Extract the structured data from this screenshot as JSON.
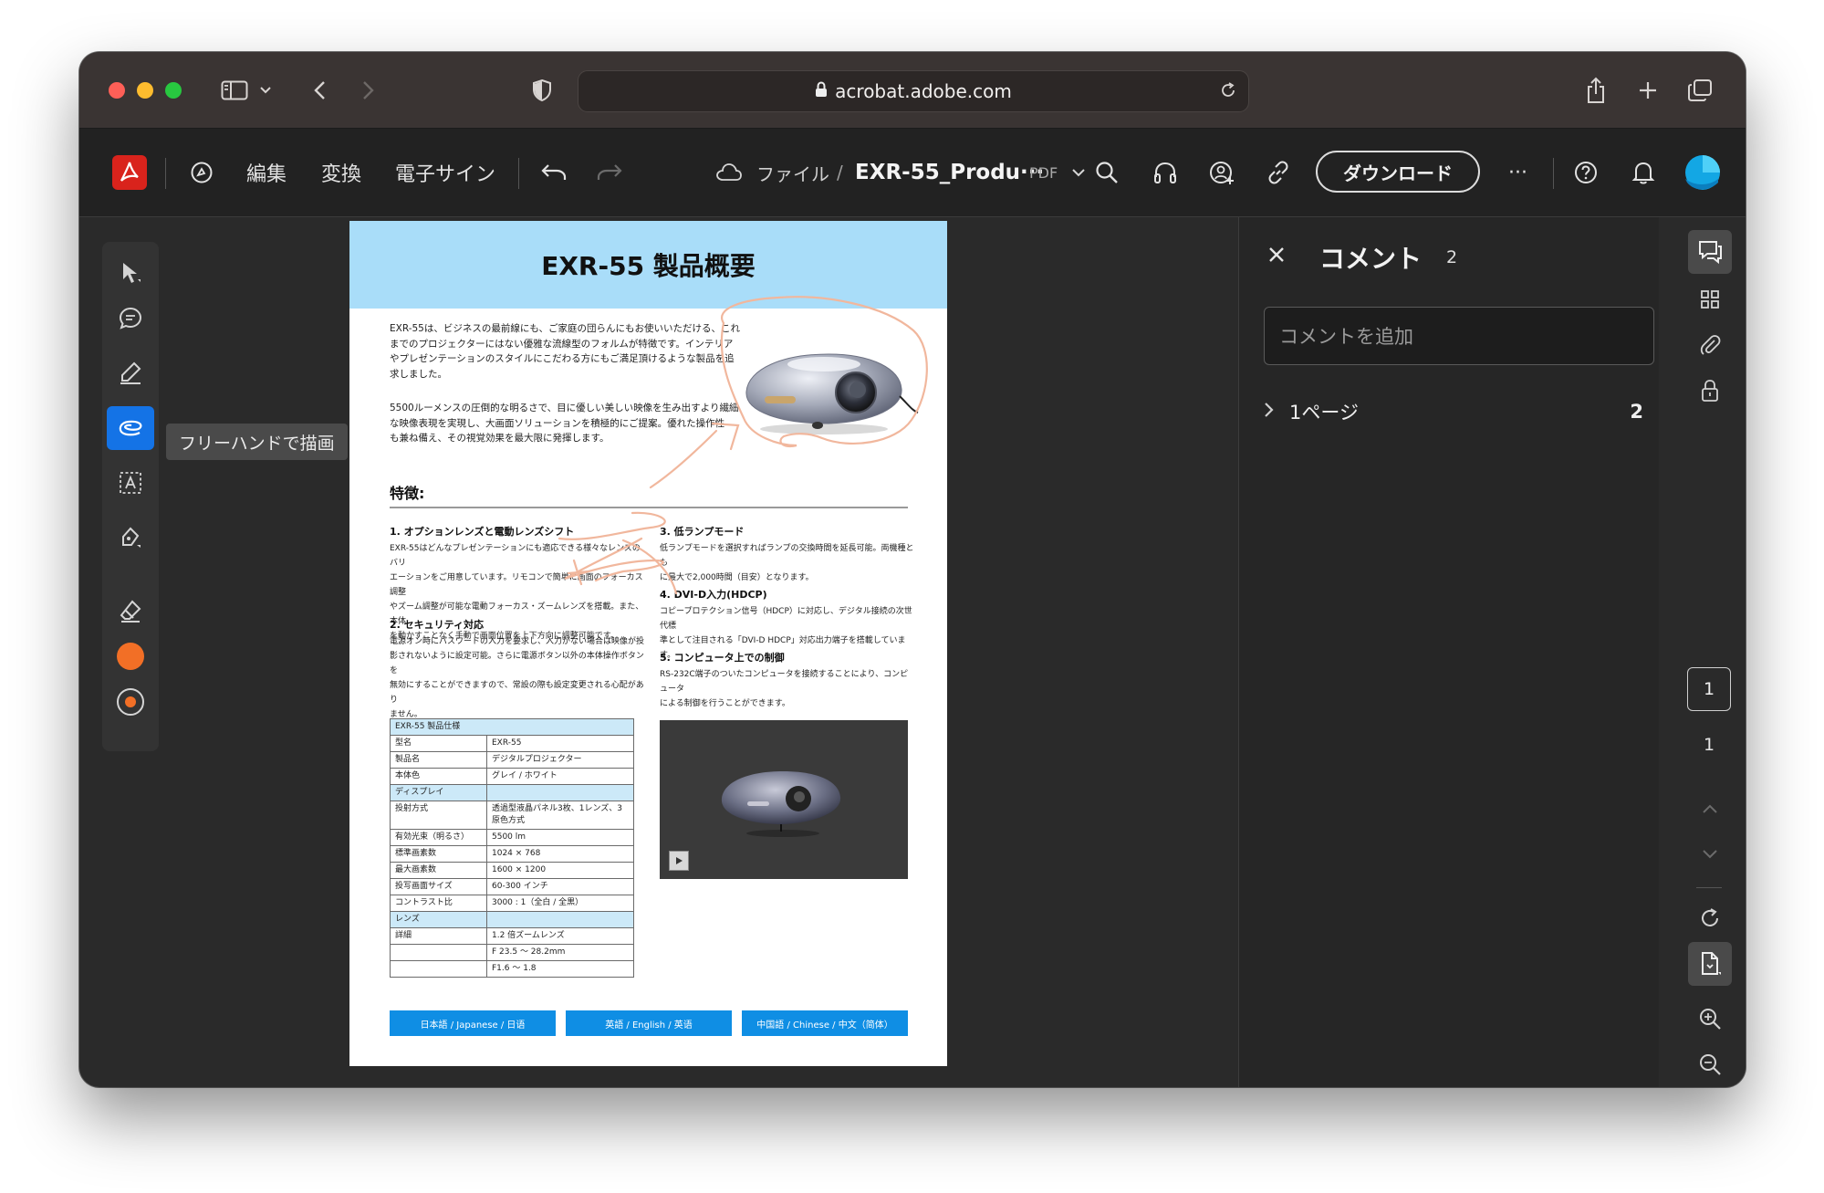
{
  "browser": {
    "url": "acrobat.adobe.com"
  },
  "acrobat": {
    "menu": [
      "編集",
      "変換",
      "電子サイン"
    ],
    "breadcrumb_file": "ファイル",
    "breadcrumb_sep": "/",
    "doc_name": "EXR-55_Produ···",
    "doc_type": "PDF",
    "download_label": "ダウンロード",
    "more_label": "···"
  },
  "tools": {
    "tooltip": "フリーハンドで描画",
    "active": "freehand",
    "accent": "#1473e6",
    "color_swatch": "#f26f26"
  },
  "document": {
    "title": "EXR-55 製品概要",
    "intro1": [
      "EXR-55は、ビジネスの最前線にも、ご家庭の団らんにもお使いいただける、これ",
      "までのプロジェクターにはない優雅な流線型のフォルムが特徴です。インテリア",
      "やプレゼンテーションのスタイルにこだわる方にもご満足頂けるような製品を追",
      "求しました。"
    ],
    "intro2": [
      "5500ルーメンスの圧倒的な明るさで、目に優しい美しい映像を生み出すより繊細",
      "な映像表現を実現し、大画面ソリューションを積極的にご提案。優れた操作性",
      "も兼ね備え、その視覚効果を最大限に発揮します。"
    ],
    "features_title": "特徴:",
    "features": [
      {
        "title": "1. オプションレンズと電動レンズシフト",
        "body": [
          "EXR-55はどんなプレゼンテーションにも適応できる様々なレンズのバリ",
          "エーションをご用意しています。リモコンで簡単に画面のフォーカス調整",
          "やズーム調整が可能な電動フォーカス・ズームレンズを搭載。また、本体",
          "を動かすことなく手動で画面位置を上下方向に調整可能です。"
        ]
      },
      {
        "title": "2. セキュリティ対応",
        "body": [
          "電源オン時にパスワードの入力を要求し、入力がない場合は映像が投",
          "影されないように設定可能。さらに電源ボタン以外の本体操作ボタンを",
          "無効にすることができますので、常設の際も設定変更される心配があり",
          "ません。"
        ]
      },
      {
        "title": "3. 低ランプモード",
        "body": [
          "低ランプモードを選択すればランプの交換時間を延長可能。両機種とも",
          "に最大で2,000時間（目安）となります。"
        ]
      },
      {
        "title": "4. DVI-D入力(HDCP)",
        "body": [
          "コピープロテクション信号（HDCP）に対応し、デジタル接続の次世代標",
          "準として注目される「DVI-D HDCP」対応出力端子を搭載しています。"
        ]
      },
      {
        "title": "5. コンピュータ上での制御",
        "body": [
          "RS-232C端子のついたコンピュータを接続することにより、コンピュータ",
          "による制御を行うことができます。"
        ]
      }
    ],
    "spec_table": [
      {
        "k": "EXR-55 製品仕様",
        "v": "",
        "section": true,
        "span": true
      },
      {
        "k": "型名",
        "v": "EXR-55"
      },
      {
        "k": "製品名",
        "v": "デジタルプロジェクター"
      },
      {
        "k": "本体色",
        "v": "グレイ / ホワイト"
      },
      {
        "k": "ディスプレイ",
        "v": "",
        "section": true
      },
      {
        "k": "投射方式",
        "v": "透過型液晶パネル3枚、1レンズ、3原色方式"
      },
      {
        "k": "有効光束（明るさ）",
        "v": "5500 lm"
      },
      {
        "k": "標準画素数",
        "v": "1024 × 768"
      },
      {
        "k": "最大画素数",
        "v": "1600 × 1200"
      },
      {
        "k": "投写画面サイズ",
        "v": "60-300 インチ"
      },
      {
        "k": "コントラスト比",
        "v": "3000 : 1（全白 / 全黒）"
      },
      {
        "k": "レンズ",
        "v": "",
        "section": true
      },
      {
        "k": "詳細",
        "v": "1.2 倍ズームレンズ"
      },
      {
        "k": "",
        "v": "F 23.5 〜 28.2mm"
      },
      {
        "k": "",
        "v": "F1.6 〜 1.8"
      }
    ],
    "languages": [
      "日本語 / Japanese / 日语",
      "英語 / English / 英语",
      "中国語 / Chinese / 中文（简体）"
    ]
  },
  "comments_panel": {
    "title": "コメント",
    "count": "2",
    "input_placeholder": "コメントを追加",
    "page_group_label": "1ページ",
    "page_group_count": "2"
  },
  "right_rail": {
    "current_page": "1",
    "total_pages": "1"
  }
}
